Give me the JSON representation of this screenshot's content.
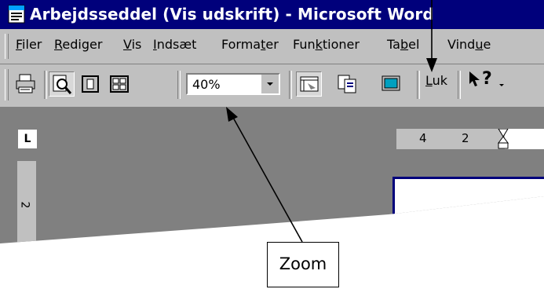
{
  "window": {
    "title": "Arbejdsseddel (Vis udskrift) - Microsoft Word"
  },
  "menubar": {
    "items": [
      {
        "pre": "",
        "accel": "F",
        "post": "iler"
      },
      {
        "pre": "",
        "accel": "R",
        "post": "ediger"
      },
      {
        "pre": "",
        "accel": "V",
        "post": "is"
      },
      {
        "pre": "",
        "accel": "I",
        "post": "ndsæt"
      },
      {
        "pre": "Forma",
        "accel": "t",
        "post": "er"
      },
      {
        "pre": "Fun",
        "accel": "k",
        "post": "tioner"
      },
      {
        "pre": "Ta",
        "accel": "b",
        "post": "el"
      },
      {
        "pre": "Vind",
        "accel": "u",
        "post": "e"
      }
    ]
  },
  "toolbar": {
    "zoom_value": "40%",
    "close_pre": "",
    "close_accel": "L",
    "close_post": "uk",
    "help_symbol": "?"
  },
  "workspace": {
    "ruler_corner": "L",
    "h_ruler_numbers": [
      "4",
      "2"
    ],
    "v_ruler_number": "2"
  },
  "callout": {
    "label": "Zoom"
  },
  "colors": {
    "titlebar": "#00007b",
    "chrome": "#c0c0c0",
    "workspace": "#808080"
  },
  "icons": [
    "word-document-icon",
    "print-icon",
    "magnifier-icon",
    "one-page-icon",
    "multiple-pages-icon",
    "zoom-dropdown-arrow-icon",
    "view-ruler-icon",
    "shrink-to-fit-icon",
    "full-screen-icon",
    "context-help-icon",
    "ruler-tab-icon",
    "indent-marker-icon"
  ]
}
